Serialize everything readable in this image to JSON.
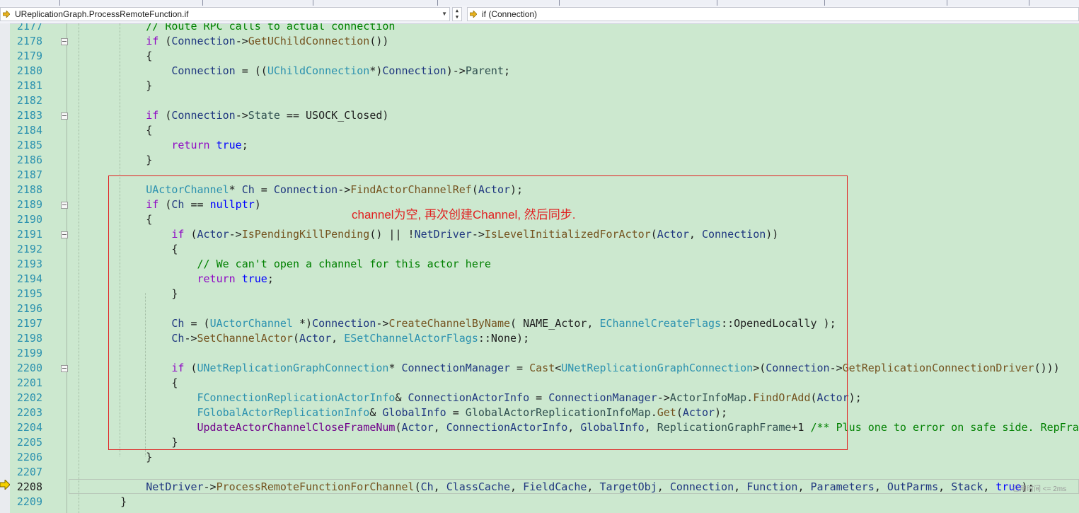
{
  "navbar": {
    "scope_combo": "UReplicationGraph.ProcessRemoteFunction.if",
    "member_combo": "if (Connection)"
  },
  "editor": {
    "lines": [
      {
        "n": "2177",
        "t": [
          [
            "cmt",
            "        // Route RPC calls to actual connection"
          ]
        ]
      },
      {
        "n": "2178",
        "t": [
          [
            "kw",
            "        if"
          ],
          [
            "nm",
            " ("
          ],
          [
            "vr",
            "Connection"
          ],
          [
            "nm",
            "->"
          ],
          [
            "fn",
            "GetUChildConnection"
          ],
          [
            "nm",
            "())"
          ]
        ]
      },
      {
        "n": "2179",
        "t": [
          [
            "nm",
            "        {"
          ]
        ]
      },
      {
        "n": "2180",
        "t": [
          [
            "vr",
            "            Connection"
          ],
          [
            "nm",
            " = (("
          ],
          [
            "tp",
            "UChildConnection"
          ],
          [
            "nm",
            "*)"
          ],
          [
            "vr",
            "Connection"
          ],
          [
            "nm",
            ")->"
          ],
          [
            "mb",
            "Parent"
          ],
          [
            "nm",
            ";"
          ]
        ]
      },
      {
        "n": "2181",
        "t": [
          [
            "nm",
            "        }"
          ]
        ]
      },
      {
        "n": "2182",
        "t": [
          [
            "nm",
            ""
          ]
        ]
      },
      {
        "n": "2183",
        "t": [
          [
            "kw",
            "        if"
          ],
          [
            "nm",
            " ("
          ],
          [
            "vr",
            "Connection"
          ],
          [
            "nm",
            "->"
          ],
          [
            "mb",
            "State"
          ],
          [
            "nm",
            " == USOCK_Closed)"
          ]
        ]
      },
      {
        "n": "2184",
        "t": [
          [
            "nm",
            "        {"
          ]
        ]
      },
      {
        "n": "2185",
        "t": [
          [
            "kw",
            "            return"
          ],
          [
            "nm",
            " "
          ],
          [
            "cb",
            "true"
          ],
          [
            "nm",
            ";"
          ]
        ]
      },
      {
        "n": "2186",
        "t": [
          [
            "nm",
            "        }"
          ]
        ]
      },
      {
        "n": "2187",
        "t": [
          [
            "nm",
            ""
          ]
        ]
      },
      {
        "n": "2188",
        "t": [
          [
            "tp",
            "        UActorChannel"
          ],
          [
            "nm",
            "* "
          ],
          [
            "vr",
            "Ch"
          ],
          [
            "nm",
            " = "
          ],
          [
            "vr",
            "Connection"
          ],
          [
            "nm",
            "->"
          ],
          [
            "fn",
            "FindActorChannelRef"
          ],
          [
            "nm",
            "("
          ],
          [
            "vr",
            "Actor"
          ],
          [
            "nm",
            ");"
          ]
        ]
      },
      {
        "n": "2189",
        "t": [
          [
            "kw",
            "        if"
          ],
          [
            "nm",
            " ("
          ],
          [
            "vr",
            "Ch"
          ],
          [
            "nm",
            " == "
          ],
          [
            "cb",
            "nullptr"
          ],
          [
            "nm",
            ")"
          ]
        ]
      },
      {
        "n": "2190",
        "t": [
          [
            "nm",
            "        {"
          ]
        ]
      },
      {
        "n": "2191",
        "t": [
          [
            "kw",
            "            if"
          ],
          [
            "nm",
            " ("
          ],
          [
            "vr",
            "Actor"
          ],
          [
            "nm",
            "->"
          ],
          [
            "fn",
            "IsPendingKillPending"
          ],
          [
            "nm",
            "() || !"
          ],
          [
            "vr",
            "NetDriver"
          ],
          [
            "nm",
            "->"
          ],
          [
            "fn",
            "IsLevelInitializedForActor"
          ],
          [
            "nm",
            "("
          ],
          [
            "vr",
            "Actor"
          ],
          [
            "nm",
            ", "
          ],
          [
            "vr",
            "Connection"
          ],
          [
            "nm",
            "))"
          ]
        ]
      },
      {
        "n": "2192",
        "t": [
          [
            "nm",
            "            {"
          ]
        ]
      },
      {
        "n": "2193",
        "t": [
          [
            "cmt",
            "                // We can't open a channel for this actor here"
          ]
        ]
      },
      {
        "n": "2194",
        "t": [
          [
            "kw",
            "                return"
          ],
          [
            "nm",
            " "
          ],
          [
            "cb",
            "true"
          ],
          [
            "nm",
            ";"
          ]
        ]
      },
      {
        "n": "2195",
        "t": [
          [
            "nm",
            "            }"
          ]
        ]
      },
      {
        "n": "2196",
        "t": [
          [
            "nm",
            ""
          ]
        ]
      },
      {
        "n": "2197",
        "t": [
          [
            "vr",
            "            Ch"
          ],
          [
            "nm",
            " = ("
          ],
          [
            "tp",
            "UActorChannel"
          ],
          [
            "nm",
            " *)"
          ],
          [
            "vr",
            "Connection"
          ],
          [
            "nm",
            "->"
          ],
          [
            "fn",
            "CreateChannelByName"
          ],
          [
            "nm",
            "( NAME_Actor, "
          ],
          [
            "tp",
            "EChannelCreateFlags"
          ],
          [
            "nm",
            "::OpenedLocally );"
          ]
        ]
      },
      {
        "n": "2198",
        "t": [
          [
            "vr",
            "            Ch"
          ],
          [
            "nm",
            "->"
          ],
          [
            "fn",
            "SetChannelActor"
          ],
          [
            "nm",
            "("
          ],
          [
            "vr",
            "Actor"
          ],
          [
            "nm",
            ", "
          ],
          [
            "tp",
            "ESetChannelActorFlags"
          ],
          [
            "nm",
            "::None);"
          ]
        ]
      },
      {
        "n": "2199",
        "t": [
          [
            "nm",
            ""
          ]
        ]
      },
      {
        "n": "2200",
        "t": [
          [
            "kw",
            "            if"
          ],
          [
            "nm",
            " ("
          ],
          [
            "tp",
            "UNetReplicationGraphConnection"
          ],
          [
            "nm",
            "* "
          ],
          [
            "vr",
            "ConnectionManager"
          ],
          [
            "nm",
            " = "
          ],
          [
            "fn",
            "Cast"
          ],
          [
            "nm",
            "<"
          ],
          [
            "tp",
            "UNetReplicationGraphConnection"
          ],
          [
            "nm",
            ">("
          ],
          [
            "vr",
            "Connection"
          ],
          [
            "nm",
            "->"
          ],
          [
            "fn",
            "GetReplicationConnectionDriver"
          ],
          [
            "nm",
            "()))"
          ]
        ]
      },
      {
        "n": "2201",
        "t": [
          [
            "nm",
            "            {"
          ]
        ]
      },
      {
        "n": "2202",
        "t": [
          [
            "tp",
            "                FConnectionReplicationActorInfo"
          ],
          [
            "nm",
            "& "
          ],
          [
            "vr",
            "ConnectionActorInfo"
          ],
          [
            "nm",
            " = "
          ],
          [
            "vr",
            "ConnectionManager"
          ],
          [
            "nm",
            "->"
          ],
          [
            "mb",
            "ActorInfoMap"
          ],
          [
            "nm",
            "."
          ],
          [
            "fn",
            "FindOrAdd"
          ],
          [
            "nm",
            "("
          ],
          [
            "vr",
            "Actor"
          ],
          [
            "nm",
            ");"
          ]
        ]
      },
      {
        "n": "2203",
        "t": [
          [
            "tp",
            "                FGlobalActorReplicationInfo"
          ],
          [
            "nm",
            "& "
          ],
          [
            "vr",
            "GlobalInfo"
          ],
          [
            "nm",
            " = "
          ],
          [
            "mb",
            "GlobalActorReplicationInfoMap"
          ],
          [
            "nm",
            "."
          ],
          [
            "fn",
            "Get"
          ],
          [
            "nm",
            "("
          ],
          [
            "vr",
            "Actor"
          ],
          [
            "nm",
            ");"
          ]
        ]
      },
      {
        "n": "2204",
        "t": [
          [
            "mc",
            "                UpdateActorChannelCloseFrameNum"
          ],
          [
            "nm",
            "("
          ],
          [
            "vr",
            "Actor"
          ],
          [
            "nm",
            ", "
          ],
          [
            "vr",
            "ConnectionActorInfo"
          ],
          [
            "nm",
            ", "
          ],
          [
            "vr",
            "GlobalInfo"
          ],
          [
            "nm",
            ", "
          ],
          [
            "mb",
            "ReplicationGraphFrame"
          ],
          [
            "nm",
            "+1 "
          ],
          [
            "cmt",
            "/** Plus one to error on safe side. RepFrame nu"
          ]
        ]
      },
      {
        "n": "2205",
        "t": [
          [
            "nm",
            "            }"
          ]
        ]
      },
      {
        "n": "2206",
        "t": [
          [
            "nm",
            "        }"
          ]
        ]
      },
      {
        "n": "2207",
        "t": [
          [
            "nm",
            ""
          ]
        ]
      },
      {
        "n": "2208",
        "t": [
          [
            "vr",
            "        NetDriver"
          ],
          [
            "nm",
            "->"
          ],
          [
            "fn",
            "ProcessRemoteFunctionForChannel"
          ],
          [
            "nm",
            "("
          ],
          [
            "vr",
            "Ch"
          ],
          [
            "nm",
            ", "
          ],
          [
            "vr",
            "ClassCache"
          ],
          [
            "nm",
            ", "
          ],
          [
            "vr",
            "FieldCache"
          ],
          [
            "nm",
            ", "
          ],
          [
            "vr",
            "TargetObj"
          ],
          [
            "nm",
            ", "
          ],
          [
            "vr",
            "Connection"
          ],
          [
            "nm",
            ", "
          ],
          [
            "vr",
            "Function"
          ],
          [
            "nm",
            ", "
          ],
          [
            "vr",
            "Parameters"
          ],
          [
            "nm",
            ", "
          ],
          [
            "vr",
            "OutParms"
          ],
          [
            "nm",
            ", "
          ],
          [
            "vr",
            "Stack"
          ],
          [
            "nm",
            ", "
          ],
          [
            "cb",
            "true"
          ],
          [
            "nm",
            ");"
          ]
        ]
      },
      {
        "n": "2209",
        "t": [
          [
            "nm",
            "    }"
          ]
        ]
      }
    ]
  },
  "annotation_text": "channel为空, 再次创建Channel, 然后同步.",
  "elapsed_hint": "已用时间 <= 2ms"
}
